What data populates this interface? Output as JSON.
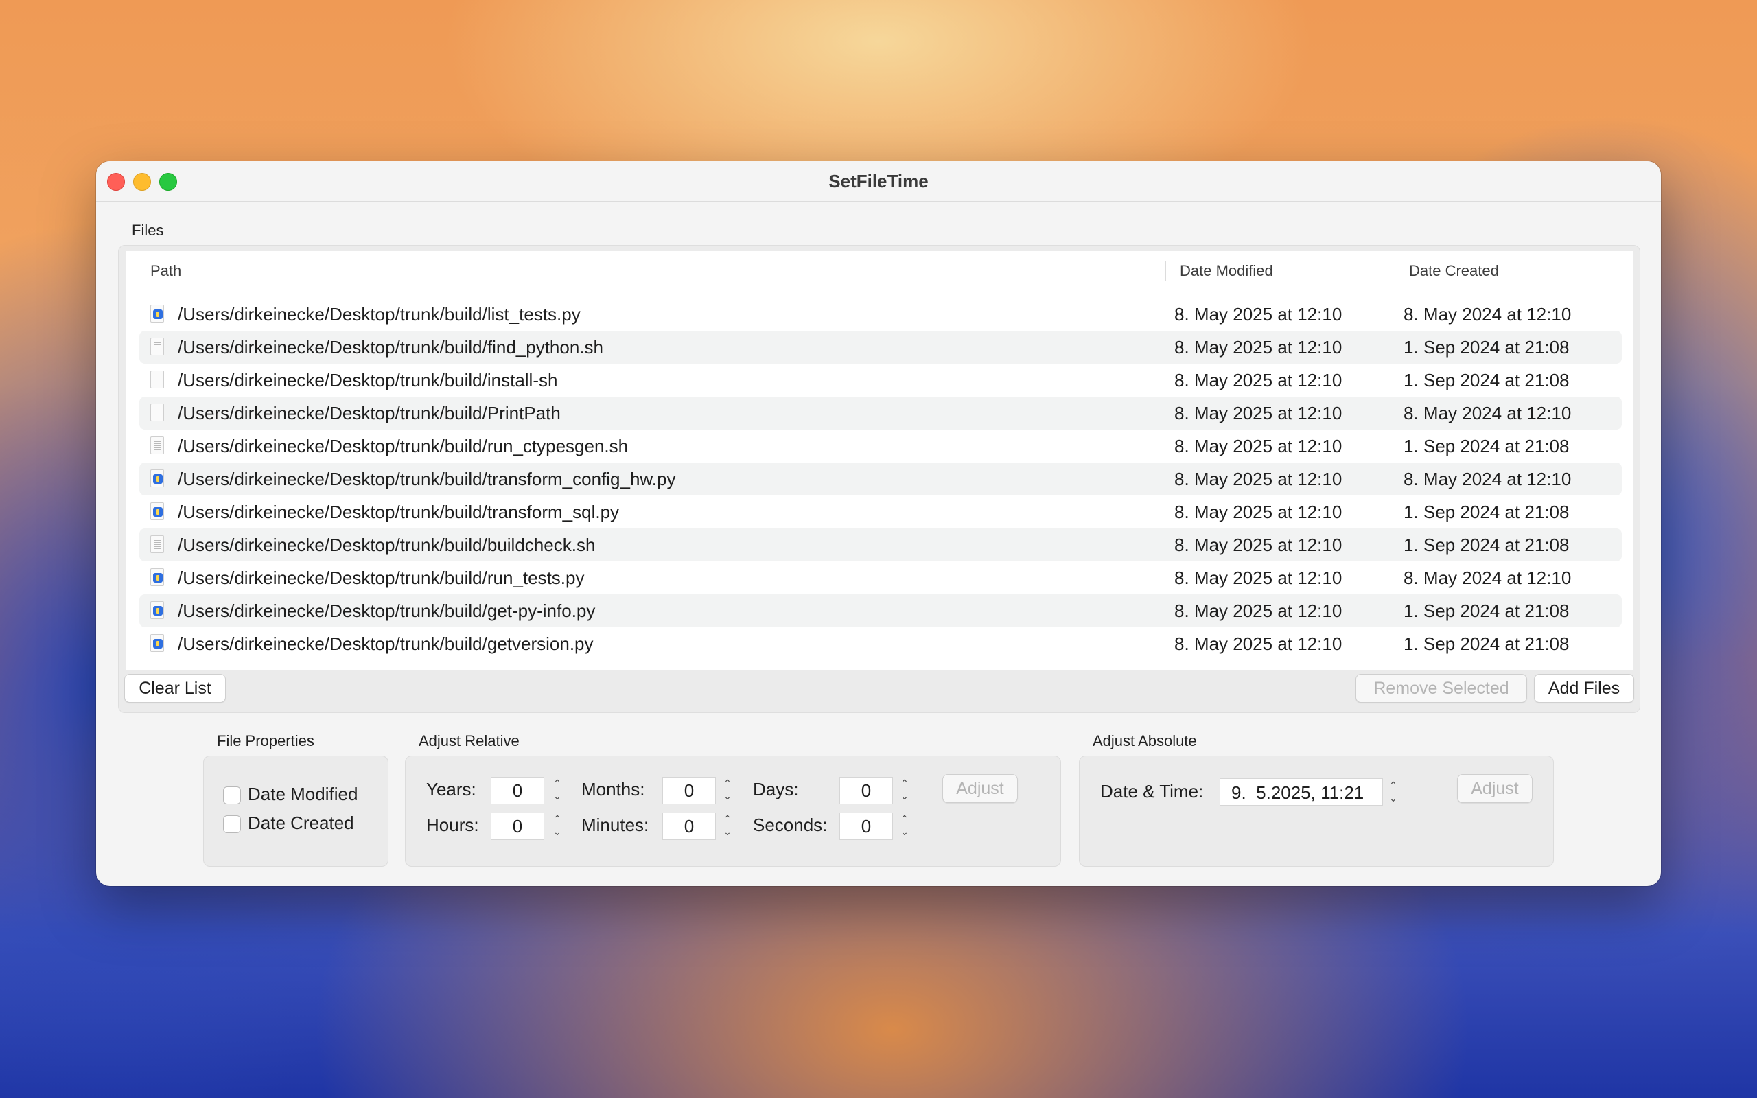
{
  "window": {
    "title": "SetFileTime"
  },
  "files": {
    "group_label": "Files",
    "columns": {
      "path": "Path",
      "date_modified": "Date Modified",
      "date_created": "Date Created"
    },
    "rows": [
      {
        "icon": "python-file-icon",
        "path": "/Users/dirkeinecke/Desktop/trunk/build/list_tests.py",
        "date_modified": "8. May 2025 at 12:10",
        "date_created": "8. May 2024 at 12:10"
      },
      {
        "icon": "script-file-icon",
        "path": "/Users/dirkeinecke/Desktop/trunk/build/find_python.sh",
        "date_modified": "8. May 2025 at 12:10",
        "date_created": "1. Sep 2024 at 21:08"
      },
      {
        "icon": "blank-file-icon",
        "path": "/Users/dirkeinecke/Desktop/trunk/build/install-sh",
        "date_modified": "8. May 2025 at 12:10",
        "date_created": "1. Sep 2024 at 21:08"
      },
      {
        "icon": "blank-file-icon",
        "path": "/Users/dirkeinecke/Desktop/trunk/build/PrintPath",
        "date_modified": "8. May 2025 at 12:10",
        "date_created": "8. May 2024 at 12:10"
      },
      {
        "icon": "script-file-icon",
        "path": "/Users/dirkeinecke/Desktop/trunk/build/run_ctypesgen.sh",
        "date_modified": "8. May 2025 at 12:10",
        "date_created": "1. Sep 2024 at 21:08"
      },
      {
        "icon": "python-file-icon",
        "path": "/Users/dirkeinecke/Desktop/trunk/build/transform_config_hw.py",
        "date_modified": "8. May 2025 at 12:10",
        "date_created": "8. May 2024 at 12:10"
      },
      {
        "icon": "python-file-icon",
        "path": "/Users/dirkeinecke/Desktop/trunk/build/transform_sql.py",
        "date_modified": "8. May 2025 at 12:10",
        "date_created": "1. Sep 2024 at 21:08"
      },
      {
        "icon": "script-file-icon",
        "path": "/Users/dirkeinecke/Desktop/trunk/build/buildcheck.sh",
        "date_modified": "8. May 2025 at 12:10",
        "date_created": "1. Sep 2024 at 21:08"
      },
      {
        "icon": "python-file-icon",
        "path": "/Users/dirkeinecke/Desktop/trunk/build/run_tests.py",
        "date_modified": "8. May 2025 at 12:10",
        "date_created": "8. May 2024 at 12:10"
      },
      {
        "icon": "python-file-icon",
        "path": "/Users/dirkeinecke/Desktop/trunk/build/get-py-info.py",
        "date_modified": "8. May 2025 at 12:10",
        "date_created": "1. Sep 2024 at 21:08"
      },
      {
        "icon": "python-file-icon",
        "path": "/Users/dirkeinecke/Desktop/trunk/build/getversion.py",
        "date_modified": "8. May 2025 at 12:10",
        "date_created": "1. Sep 2024 at 21:08"
      }
    ],
    "buttons": {
      "clear": "Clear List",
      "remove": "Remove Selected",
      "add": "Add Files"
    }
  },
  "file_properties": {
    "label": "File Properties",
    "date_modified": {
      "label": "Date Modified",
      "checked": false
    },
    "date_created": {
      "label": "Date Created",
      "checked": false
    }
  },
  "adjust_relative": {
    "label": "Adjust Relative",
    "years": {
      "label": "Years:",
      "value": "0"
    },
    "months": {
      "label": "Months:",
      "value": "0"
    },
    "days": {
      "label": "Days:",
      "value": "0"
    },
    "hours": {
      "label": "Hours:",
      "value": "0"
    },
    "minutes": {
      "label": "Minutes:",
      "value": "0"
    },
    "seconds": {
      "label": "Seconds:",
      "value": "0"
    },
    "button": "Adjust"
  },
  "adjust_absolute": {
    "label": "Adjust Absolute",
    "datetime_label": "Date & Time:",
    "datetime_value": "9.  5.2025, 11:21",
    "button": "Adjust"
  },
  "colors": {
    "close": "#ff5f57",
    "minimize": "#febc2e",
    "maximize": "#28c840",
    "python_icon": "#2f6fe0"
  }
}
